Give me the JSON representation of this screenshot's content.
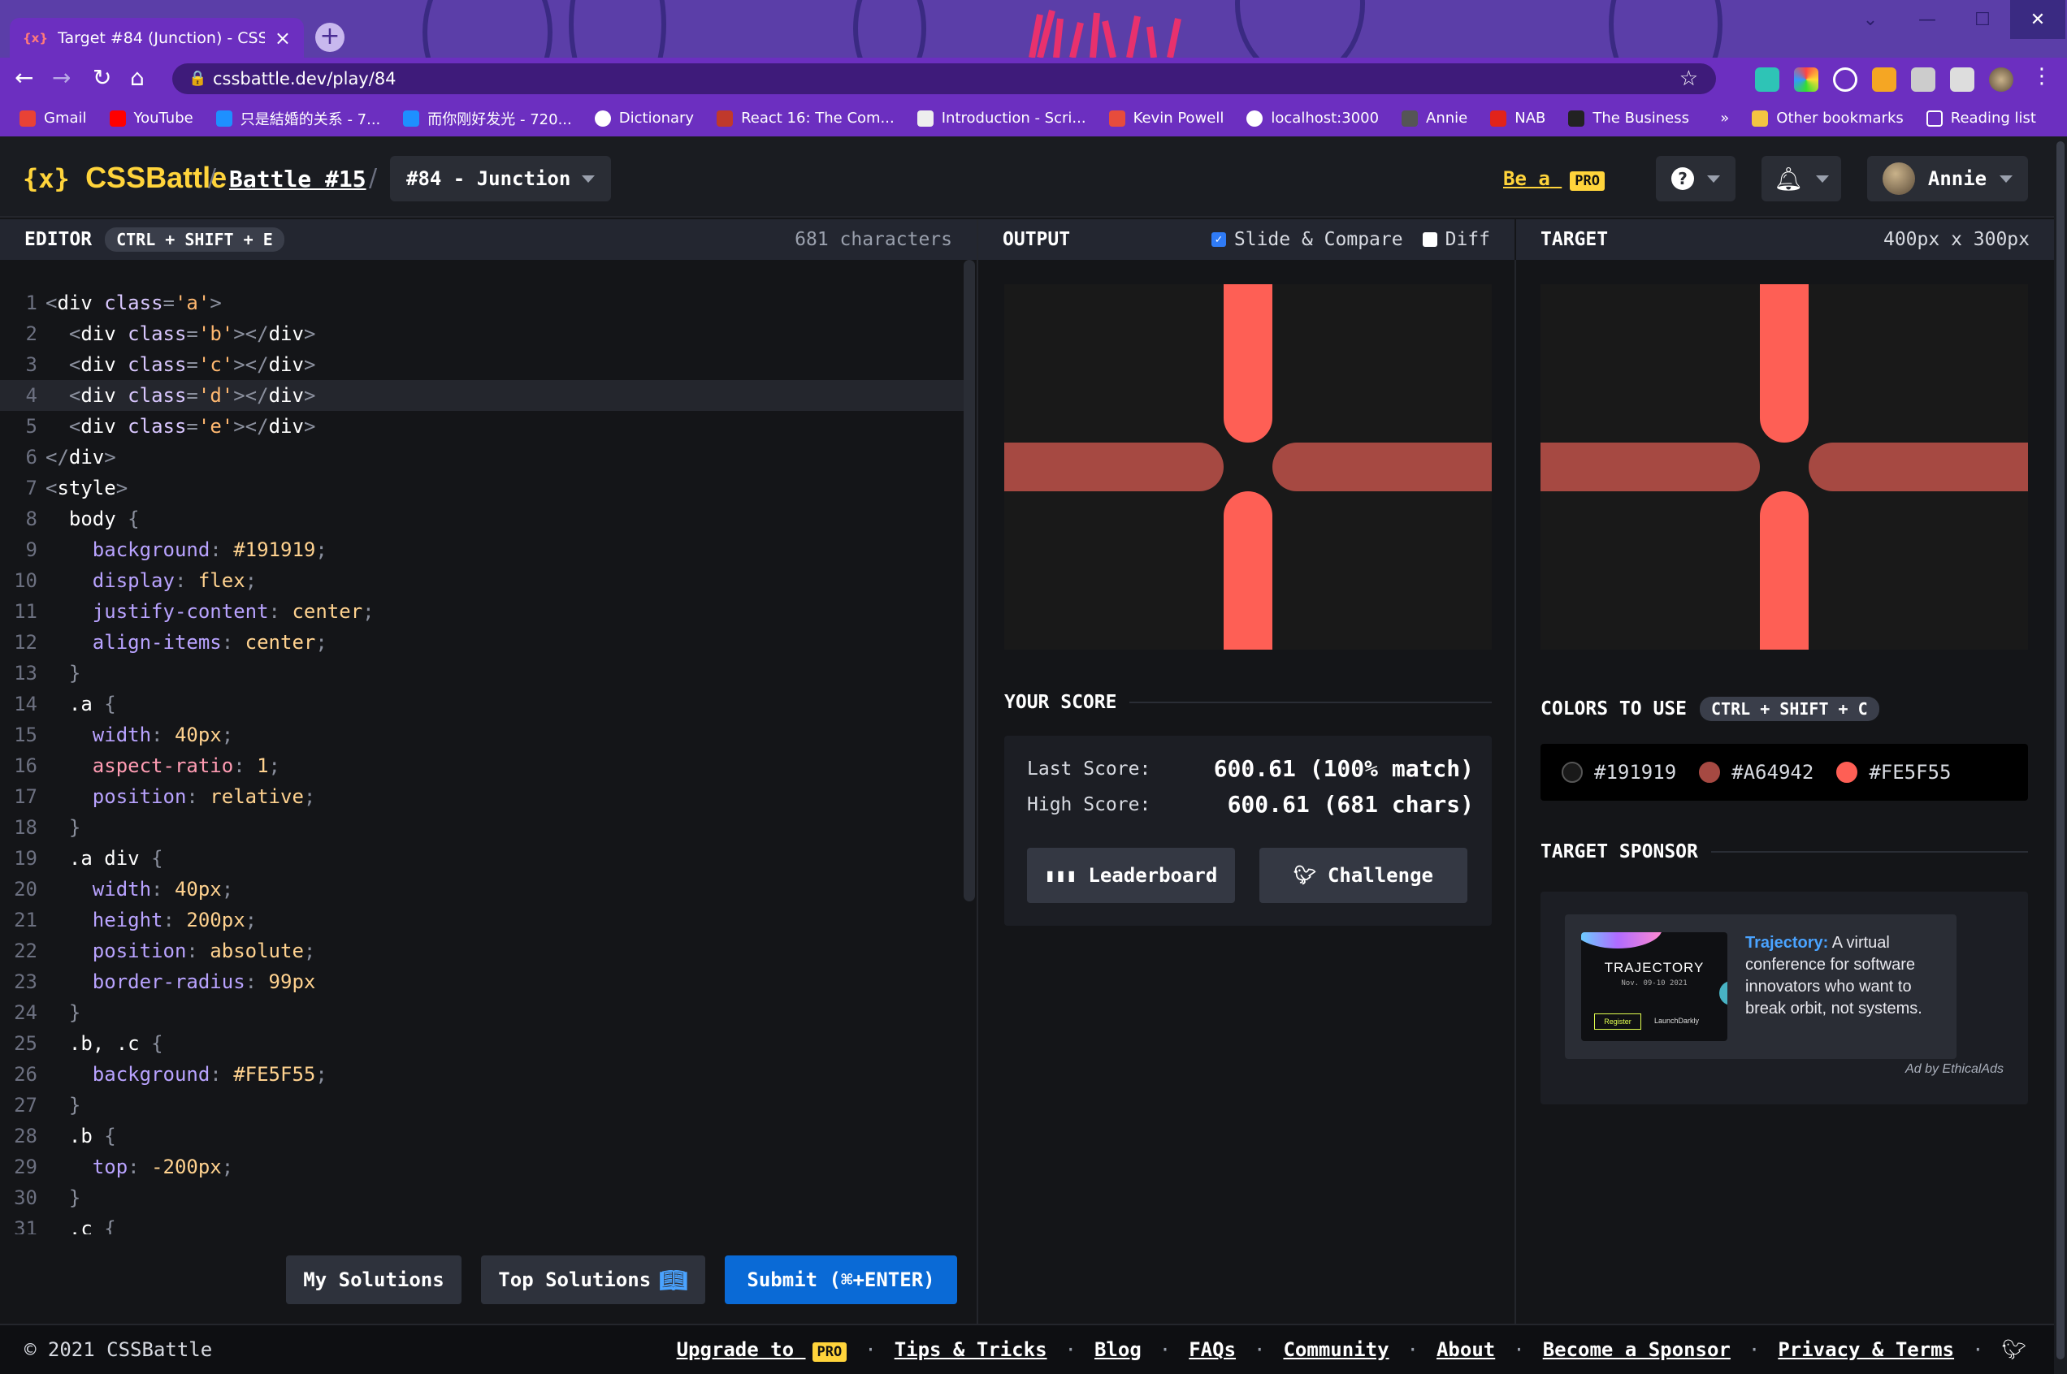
{
  "browser": {
    "tab_title": "Target #84 (Junction) - CSSBattle",
    "tab_favicon": "{x}",
    "url": "cssbattle.dev/play/84",
    "bookmarks": [
      "Gmail",
      "YouTube",
      "只是結婚的关系 - 7...",
      "而你刚好发光 - 720...",
      "Dictionary",
      "React 16: The Com...",
      "Introduction - Scri...",
      "Kevin Powell",
      "localhost:3000",
      "Annie",
      "NAB",
      "The Business"
    ],
    "bookmarks_more": "»",
    "other_bookmarks": "Other bookmarks",
    "reading_list": "Reading list"
  },
  "header": {
    "logo_mark": "{x}",
    "logo_text": "CSSBattle",
    "crumb_sep": "/",
    "battle": "Battle #15",
    "target": "#84 - Junction",
    "be_a": "Be a",
    "pro": "PRO",
    "help": "?",
    "username": "Annie"
  },
  "editor": {
    "heading": "EDITOR",
    "shortcut": "CTRL + SHIFT + E",
    "char_count": "681 characters",
    "my_solutions": "My Solutions",
    "top_solutions": "Top Solutions",
    "submit": "Submit (⌘+ENTER)"
  },
  "output": {
    "heading": "OUTPUT",
    "slide_compare": "Slide & Compare",
    "diff": "Diff"
  },
  "target_panel": {
    "heading": "TARGET",
    "size": "400px x 300px"
  },
  "score": {
    "heading": "YOUR SCORE",
    "last_label": "Last Score:",
    "last_value": "600.61 (100% match)",
    "high_label": "High Score:",
    "high_value": "600.61 (681 chars)",
    "leaderboard": "Leaderboard",
    "challenge": "Challenge"
  },
  "colors": {
    "heading": "COLORS TO USE",
    "shortcut": "CTRL + SHIFT + C",
    "list": [
      "#191919",
      "#A64942",
      "#FE5F55"
    ]
  },
  "sponsor": {
    "heading": "TARGET SPONSOR",
    "brand": "Trajectory:",
    "text": "A virtual conference for software innovators who want to break orbit, not systems.",
    "img_title": "TRAJECTORY",
    "img_date": "Nov. 09-10 2021",
    "img_register": "Register",
    "img_company": "LaunchDarkly",
    "ad_by": "Ad by EthicalAds"
  },
  "footer": {
    "copyright": "© 2021 CSSBattle",
    "upgrade": "Upgrade to",
    "pro": "PRO",
    "links": [
      "Tips & Tricks",
      "Blog",
      "FAQs",
      "Community",
      "About",
      "Become a Sponsor",
      "Privacy & Terms"
    ]
  },
  "palette": {
    "background": "#191919",
    "dark_red": "#A64942",
    "light_red": "#FE5F55",
    "accent_yellow": "#ffd43b",
    "submit_blue": "#0a6ad6"
  }
}
